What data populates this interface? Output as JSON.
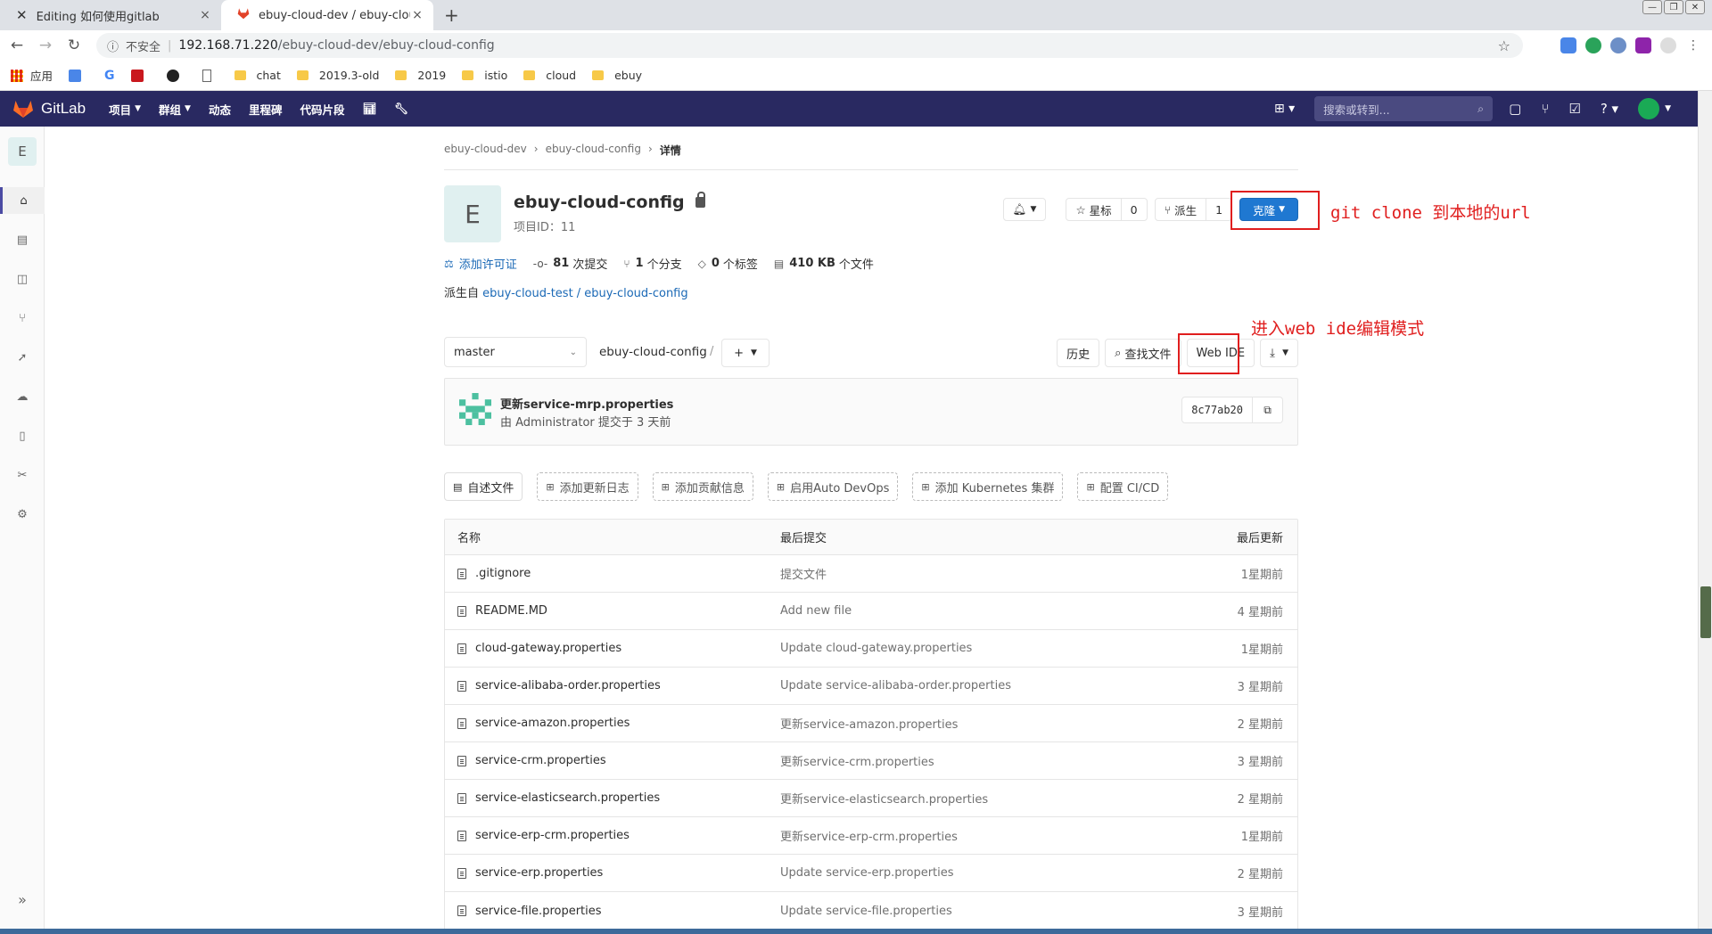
{
  "browser": {
    "tabs": [
      {
        "title": "Editing 如何使用gitlab",
        "active": false
      },
      {
        "title": "ebuy-cloud-dev / ebuy-cloud-",
        "active": true
      }
    ],
    "address": {
      "security": "不安全",
      "host": "192.168.71.220",
      "path": "/ebuy-cloud-dev/ebuy-cloud-config"
    },
    "bookmarks": [
      {
        "label": "应用",
        "icon": "apps-grid-icon"
      },
      {
        "label": "",
        "icon": "translate-icon"
      },
      {
        "label": "",
        "icon": "google-icon"
      },
      {
        "label": "",
        "icon": "csdn-icon"
      },
      {
        "label": "",
        "icon": "github-icon"
      },
      {
        "label": "",
        "icon": "page-icon"
      },
      {
        "label": "chat",
        "icon": "folder-icon"
      },
      {
        "label": "2019.3-old",
        "icon": "folder-icon"
      },
      {
        "label": "2019",
        "icon": "folder-icon"
      },
      {
        "label": "istio",
        "icon": "folder-icon"
      },
      {
        "label": "cloud",
        "icon": "folder-icon"
      },
      {
        "label": "ebuy",
        "icon": "folder-icon"
      }
    ]
  },
  "gitlab": {
    "brand": "GitLab",
    "nav": [
      {
        "label": "项目",
        "caret": true
      },
      {
        "label": "群组",
        "caret": true
      },
      {
        "label": "动态",
        "caret": false
      },
      {
        "label": "里程碑",
        "caret": false
      },
      {
        "label": "代码片段",
        "caret": false
      }
    ],
    "search_placeholder": "搜索或转到...",
    "colors": {
      "header": "#292961",
      "primary": "#1f78d1",
      "annotation": "#e01e1e"
    }
  },
  "sidebar": {
    "avatar_letter": "E"
  },
  "breadcrumb": [
    "ebuy-cloud-dev",
    "ebuy-cloud-config",
    "详情"
  ],
  "project": {
    "avatar_letter": "E",
    "name": "ebuy-cloud-config",
    "id_label": "项目ID：11",
    "star_label": "星标",
    "star_count": "0",
    "fork_label": "派生",
    "fork_count": "1",
    "clone_label": "克隆",
    "stats": {
      "license": "添加许可证",
      "commits_num": "81",
      "commits_label": "次提交",
      "branches_num": "1",
      "branches_label": "个分支",
      "tags_num": "0",
      "tags_label": "个标签",
      "size_num": "410 KB",
      "size_label": "个文件"
    },
    "forked_prefix": "派生自",
    "forked_from": "ebuy-cloud-test / ebuy-cloud-config"
  },
  "tree": {
    "branch": "master",
    "path": "ebuy-cloud-config",
    "history": "历史",
    "find_file": "查找文件",
    "web_ide": "Web IDE"
  },
  "commit": {
    "title": "更新service-mrp.properties",
    "byline": "由 Administrator 提交于 3 天前",
    "sha": "8c77ab20"
  },
  "chips": [
    {
      "label": "自述文件",
      "style": "solid"
    },
    {
      "label": "添加更新日志",
      "style": "dashed"
    },
    {
      "label": "添加贡献信息",
      "style": "dashed"
    },
    {
      "label": "启用Auto DevOps",
      "style": "dashed"
    },
    {
      "label": "添加 Kubernetes 集群",
      "style": "dashed"
    },
    {
      "label": "配置 CI/CD",
      "style": "dashed"
    }
  ],
  "files": {
    "headers": {
      "name": "名称",
      "commit": "最后提交",
      "updated": "最后更新"
    },
    "rows": [
      {
        "name": ".gitignore",
        "commit": "提交文件",
        "updated": "1星期前"
      },
      {
        "name": "README.MD",
        "commit": "Add new file",
        "updated": "4 星期前"
      },
      {
        "name": "cloud-gateway.properties",
        "commit": "Update cloud-gateway.properties",
        "updated": "1星期前"
      },
      {
        "name": "service-alibaba-order.properties",
        "commit": "Update service-alibaba-order.properties",
        "updated": "3 星期前"
      },
      {
        "name": "service-amazon.properties",
        "commit": "更新service-amazon.properties",
        "updated": "2 星期前"
      },
      {
        "name": "service-crm.properties",
        "commit": "更新service-crm.properties",
        "updated": "3 星期前"
      },
      {
        "name": "service-elasticsearch.properties",
        "commit": "更新service-elasticsearch.properties",
        "updated": "2 星期前"
      },
      {
        "name": "service-erp-crm.properties",
        "commit": "更新service-erp-crm.properties",
        "updated": "1星期前"
      },
      {
        "name": "service-erp.properties",
        "commit": "Update service-erp.properties",
        "updated": "2 星期前"
      },
      {
        "name": "service-file.properties",
        "commit": "Update service-file.properties",
        "updated": "3 星期前"
      }
    ]
  },
  "annotations": {
    "clone_note": "git clone 到本地的url",
    "webide_note": "进入web ide编辑模式"
  }
}
